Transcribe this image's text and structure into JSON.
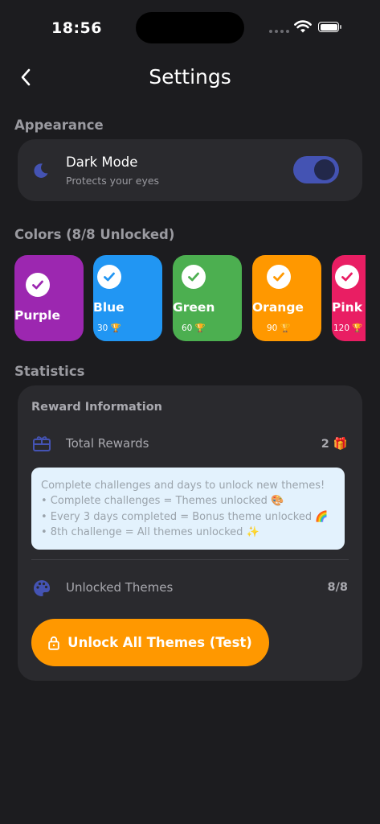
{
  "status_bar": {
    "time": "18:56"
  },
  "header": {
    "title": "Settings"
  },
  "appearance": {
    "label": "Appearance",
    "dark_mode": {
      "title": "Dark Mode",
      "subtitle": "Protects your eyes",
      "enabled": true
    }
  },
  "colors": {
    "label": "Colors (8/8 Unlocked)",
    "items": [
      {
        "name": "Purple",
        "cost": "",
        "color": "#9c27b0",
        "checked": true
      },
      {
        "name": "Blue",
        "cost": "30 🏆",
        "color": "#2196f3",
        "checked": true
      },
      {
        "name": "Green",
        "cost": "60 🏆",
        "color": "#4caf50",
        "checked": true
      },
      {
        "name": "Orange",
        "cost": "90 🏆",
        "color": "#ff9800",
        "checked": true
      },
      {
        "name": "Pink",
        "cost": "120 🏆",
        "color": "#e91e63",
        "checked": true
      }
    ]
  },
  "statistics": {
    "label": "Statistics",
    "reward_heading": "Reward Information",
    "total_rewards": {
      "label": "Total Rewards",
      "value": "2 🎁"
    },
    "info_lines": [
      "Complete challenges and days to unlock new themes!",
      "• Complete challenges = Themes unlocked 🎨",
      "• Every 3 days completed = Bonus theme unlocked 🌈",
      "• 8th challenge = All themes unlocked ✨"
    ],
    "unlocked_themes": {
      "label": "Unlocked Themes",
      "value": "8/8"
    },
    "unlock_button": {
      "label": "Unlock All Themes (Test)"
    }
  },
  "theme_colors": {
    "accent": "#4453b3",
    "button": "#ff9800",
    "card": "#2a2a2e",
    "background": "#1c1c1f"
  }
}
